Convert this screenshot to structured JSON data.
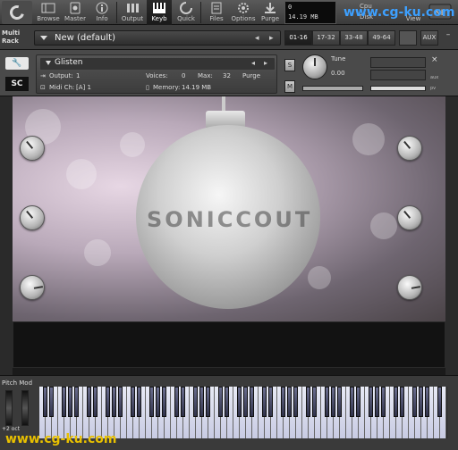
{
  "toolbar": {
    "buttons": [
      {
        "label": "Browse"
      },
      {
        "label": "Master"
      },
      {
        "label": "Info"
      },
      {
        "label": "Output"
      },
      {
        "label": "Keyb"
      },
      {
        "label": "Quick"
      },
      {
        "label": "Files"
      },
      {
        "label": "Options"
      },
      {
        "label": "Purge"
      }
    ],
    "meter_top": "0",
    "meter_mem": "14.19 MB",
    "cpu_label": "Cpu",
    "disk_label": "Disk",
    "view_label": "View"
  },
  "rack": {
    "multi_label": "Multi",
    "rack_label": "Rack",
    "preset_name": "New (default)",
    "tabs": [
      "01-16",
      "17-32",
      "33-48",
      "49-64"
    ],
    "aux_label": "AUX",
    "minus": "–"
  },
  "instrument": {
    "name": "Glisten",
    "output_label": "Output:",
    "output_value": "1",
    "voices_label": "Voices:",
    "voices_value": "0",
    "max_label": "Max:",
    "max_value": "32",
    "purge_label": "Purge",
    "midi_label": "Midi Ch:",
    "midi_value": "[A] 1",
    "memory_label": "Memory:",
    "memory_value": "14.19 MB",
    "s_label": "S",
    "m_label": "M",
    "tune_label": "Tune",
    "tune_value": "0.00",
    "close": "×",
    "aux_side": "aux",
    "pv_side": "pv",
    "logo": "SC"
  },
  "stage": {
    "ornament_text": "SONICCOUT"
  },
  "keyboard": {
    "pitch_label": "Pitch Mod",
    "octave_label": "+2 oct"
  },
  "watermarks": {
    "top": "www.cg-ku.com",
    "bottom": "www.cg-ku.com"
  },
  "colors": {
    "watermark_top": "#3da0ff",
    "watermark_bottom": "#e8c000"
  }
}
